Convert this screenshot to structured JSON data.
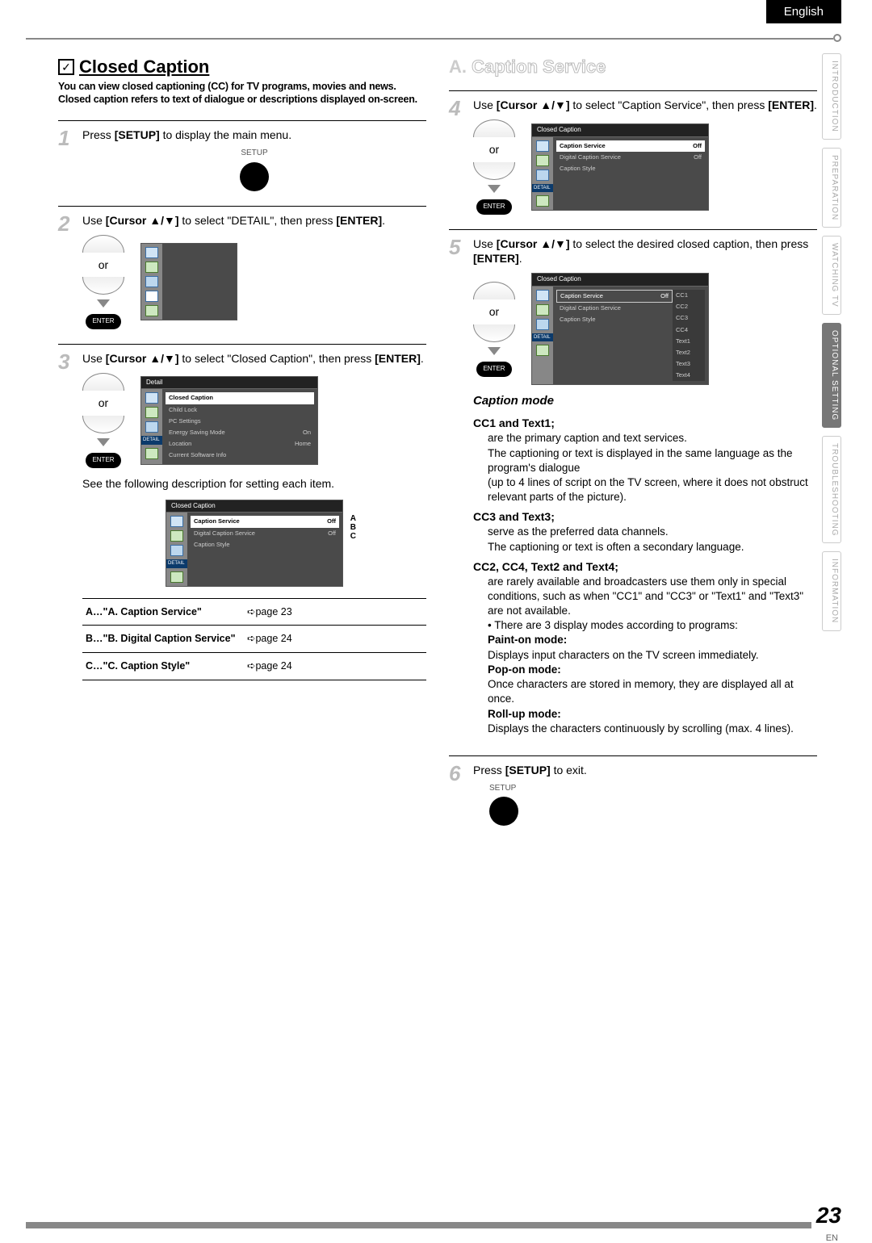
{
  "lang": "English",
  "sidebar": [
    "INTRODUCTION",
    "PREPARATION",
    "WATCHING  TV",
    "OPTIONAL  SETTING",
    "TROUBLESHOOTING",
    "INFORMATION"
  ],
  "sidebar_active_index": 3,
  "title": "Closed Caption",
  "intro": "You can view closed captioning (CC) for TV programs, movies and news. Closed caption refers to text of dialogue or descriptions displayed on-screen.",
  "steps": {
    "s1": {
      "num": "1",
      "t1": "Press ",
      "b1": "[SETUP]",
      "t2": " to display the main menu.",
      "btn_label": "SETUP"
    },
    "s2": {
      "num": "2",
      "t1": "Use ",
      "b1": "[Cursor ▲/▼]",
      "t2": " to select \"DETAIL\", then press ",
      "b2": "[ENTER]",
      "t3": "."
    },
    "s3": {
      "num": "3",
      "t1": "Use ",
      "b1": "[Cursor ▲/▼]",
      "t2": " to select \"Closed Caption\", then press ",
      "b2": "[ENTER]",
      "t3": "."
    },
    "s4": {
      "num": "4",
      "t1": "Use ",
      "b1": "[Cursor ▲/▼]",
      "t2": " to select \"Caption Service\", then press ",
      "b2": "[ENTER]",
      "t3": "."
    },
    "s5": {
      "num": "5",
      "t1": "Use ",
      "b1": "[Cursor ▲/▼]",
      "t2": " to select the desired closed caption, then press ",
      "b2": "[ENTER]",
      "t3": "."
    },
    "s6": {
      "num": "6",
      "t1": "Press ",
      "b1": "[SETUP]",
      "t2": " to exit.",
      "btn_label": "SETUP"
    }
  },
  "or": "or",
  "enter": "ENTER",
  "detail": "DETAIL",
  "sub_note": "See the following description for setting each item.",
  "menu3": {
    "title": "Detail",
    "rows": [
      {
        "l": "Closed Caption",
        "r": ""
      },
      {
        "l": "Child Lock",
        "r": ""
      },
      {
        "l": "PC Settings",
        "r": ""
      },
      {
        "l": "Energy Saving Mode",
        "r": "On"
      },
      {
        "l": "Location",
        "r": "Home"
      },
      {
        "l": "Current Software Info",
        "r": ""
      }
    ]
  },
  "menuABC": {
    "title": "Closed Caption",
    "rows": [
      {
        "l": "Caption Service",
        "r": "Off"
      },
      {
        "l": "Digital Caption Service",
        "r": "Off"
      },
      {
        "l": "Caption Style",
        "r": ""
      }
    ]
  },
  "labelsABC": {
    "a": "A",
    "b": "B",
    "c": "C"
  },
  "ref": [
    {
      "k": "A…",
      "t": "\"A. Caption Service\"",
      "p": "page 23"
    },
    {
      "k": "B…",
      "t": "\"B. Digital Caption Service\"",
      "p": "page 24"
    },
    {
      "k": "C…",
      "t": "\"C. Caption Style\"",
      "p": "page 24"
    }
  ],
  "right_heading_pre": "A.",
  "right_heading": "Caption Service",
  "menu4": {
    "title": "Closed Caption",
    "rows": [
      {
        "l": "Caption Service",
        "r": "Off"
      },
      {
        "l": "Digital Caption Service",
        "r": "Off"
      },
      {
        "l": "Caption Style",
        "r": ""
      }
    ]
  },
  "menu5": {
    "title": "Closed Caption",
    "rows": [
      {
        "l": "Caption Service",
        "r": "Off"
      },
      {
        "l": "Digital Caption Service",
        "r": ""
      },
      {
        "l": "Caption Style",
        "r": ""
      }
    ],
    "opts": [
      "CC1",
      "CC2",
      "CC3",
      "CC4",
      "Text1",
      "Text2",
      "Text3",
      "Text4"
    ]
  },
  "caption_mode_heading": "Caption mode",
  "cm": {
    "h1": "CC1 and Text1;",
    "b1a": "are the primary caption and text services.",
    "b1b": "The captioning or text is displayed in the same language as the program's dialogue",
    "b1c": "(up to 4 lines of script on the TV screen, where it does not obstruct relevant parts of the picture).",
    "h2": "CC3 and Text3;",
    "b2a": "serve as the preferred data channels.",
    "b2b": "The captioning or text is often a secondary language.",
    "h3": "CC2, CC4, Text2 and Text4;",
    "b3a": "are rarely available and broadcasters use them only in special conditions, such as when \"CC1\" and \"CC3\" or \"Text1\" and \"Text3\" are not available.",
    "bullet": "There are 3 display modes according to programs:",
    "pm_h": "Paint-on mode:",
    "pm_b": "Displays input characters on the TV screen immediately.",
    "po_h": "Pop-on mode:",
    "po_b": "Once characters are stored in memory, they are displayed all at once.",
    "ru_h": "Roll-up mode:",
    "ru_b": "Displays the characters continuously by scrolling (max. 4 lines)."
  },
  "page_num": "23",
  "page_en": "EN"
}
